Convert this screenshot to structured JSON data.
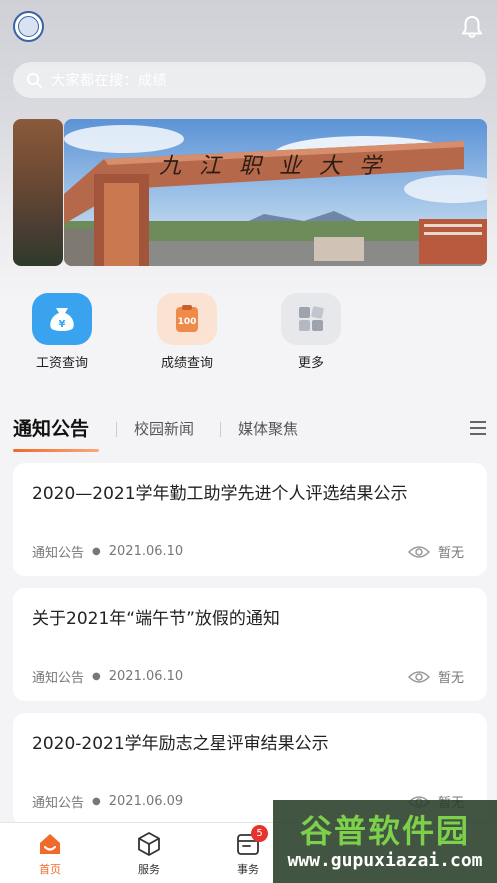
{
  "header": {
    "logo_icon": "school-emblem-icon",
    "bell_icon": "bell-icon"
  },
  "search": {
    "icon": "search-icon",
    "placeholder": "大家都在搜：成绩"
  },
  "banner": {
    "gate_sign": "九江职业大学",
    "image_icon": "campus-gate-photo"
  },
  "quick_actions": [
    {
      "label": "工资查询",
      "icon": "money-bag-icon",
      "color": "#3aa3f0"
    },
    {
      "label": "成绩查询",
      "icon": "score-100-icon",
      "color": "#f08a4b"
    },
    {
      "label": "更多",
      "icon": "grid-more-icon",
      "color": "#a8aeb8"
    }
  ],
  "tabs": {
    "items": [
      "通知公告",
      "校园新闻",
      "媒体聚焦"
    ],
    "active": 0,
    "menu_icon": "hamburger-icon"
  },
  "notices": [
    {
      "title": "2020—2021学年勤工助学先进个人评选结果公示",
      "category": "通知公告",
      "date": "2021.06.10",
      "views": "暂无"
    },
    {
      "title": "关于2021年“端午节”放假的通知",
      "category": "通知公告",
      "date": "2021.06.10",
      "views": "暂无"
    },
    {
      "title": "2020-2021学年励志之星评审结果公示",
      "category": "通知公告",
      "date": "2021.06.09",
      "views": "暂无"
    }
  ],
  "bottom_nav": {
    "items": [
      {
        "label": "首页",
        "icon": "home-icon"
      },
      {
        "label": "服务",
        "icon": "cube-icon"
      },
      {
        "label": "事务",
        "icon": "task-icon",
        "badge": "5"
      }
    ],
    "active": 0
  },
  "watermark": {
    "brand": "谷普软件园",
    "url": "www.gupuxiazai.com"
  },
  "colors": {
    "accent": "#f06a2c",
    "badge": "#e8322d"
  }
}
